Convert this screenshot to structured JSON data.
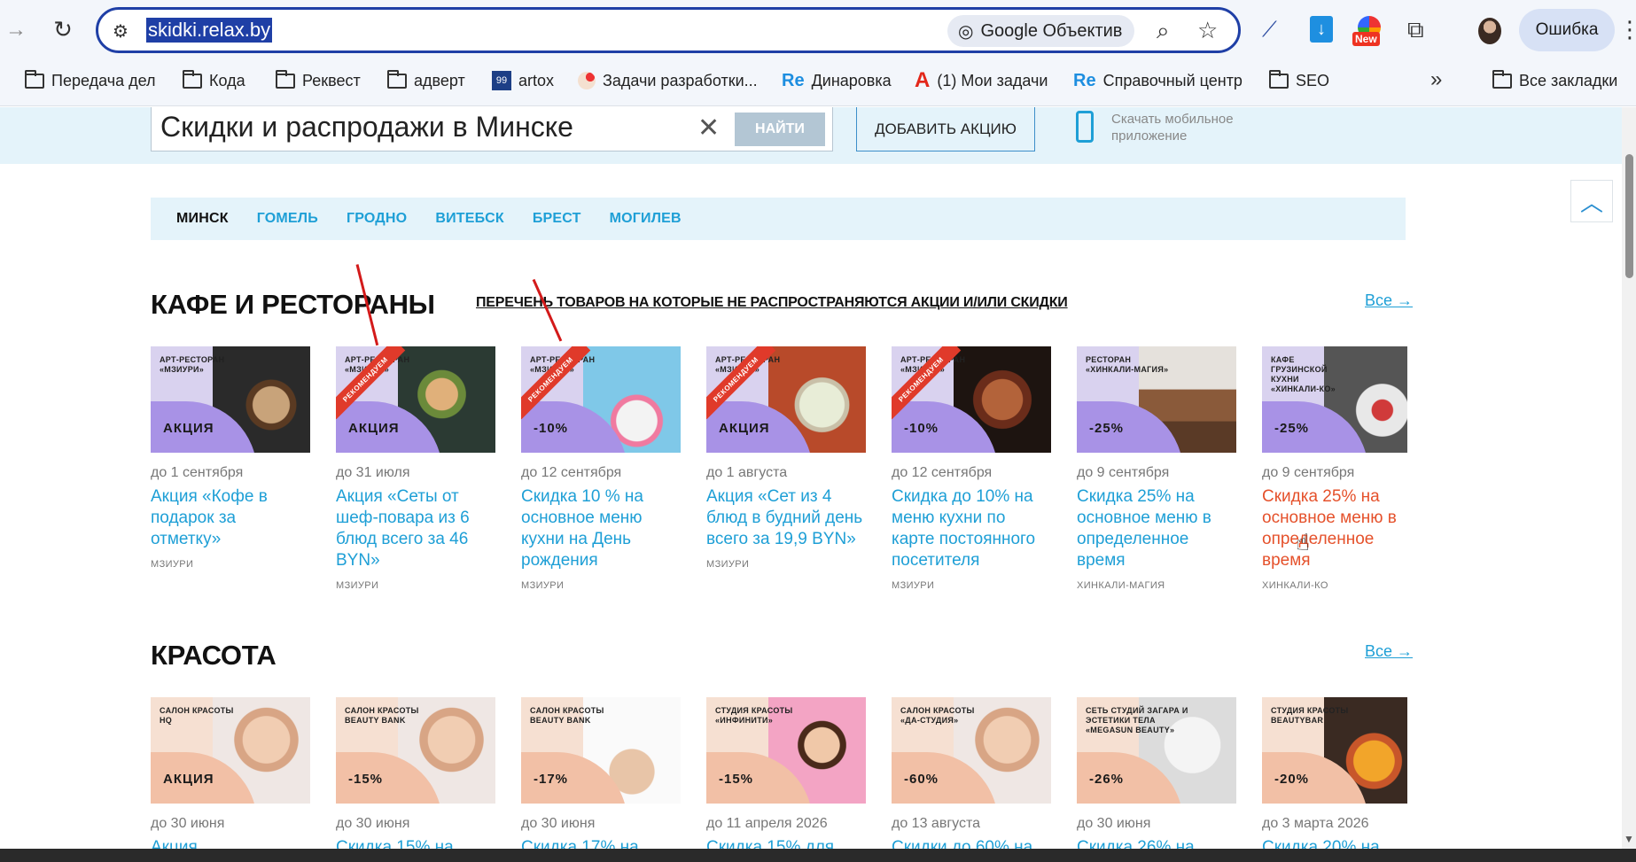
{
  "browser": {
    "url": "skidki.relax.by",
    "lens_label": "Google Объектив",
    "new_badge": "New",
    "profile_error": "Ошибка",
    "bookmarks": [
      {
        "label": "Передача дел",
        "icon": "folder-icon"
      },
      {
        "label": "Кода",
        "icon": "folder-icon"
      },
      {
        "label": "Реквест",
        "icon": "folder-icon"
      },
      {
        "label": "адверт",
        "icon": "folder-icon"
      },
      {
        "label": "artox",
        "icon": "artox-icon"
      },
      {
        "label": "Задачи разработки...",
        "icon": "app-icon"
      },
      {
        "label": "Динаровка",
        "icon": "re-icon"
      },
      {
        "label": "(1) Мои задачи",
        "icon": "a-icon"
      },
      {
        "label": "Справочный центр",
        "icon": "re-icon"
      },
      {
        "label": "SEO",
        "icon": "folder-icon"
      }
    ],
    "all_bookmarks": "Все закладки",
    "artox_icon_text": "99",
    "re_icon_text": "Re",
    "a_icon_text": "A"
  },
  "header": {
    "search_value": "Скидки и распродажи в Минске",
    "search_clear": "✕",
    "find_label": "НАЙТИ",
    "add_label": "ДОБАВИТЬ АКЦИЮ",
    "app_text": "Скачать мобильное приложение"
  },
  "cities": [
    "МИНСК",
    "ГОМЕЛЬ",
    "ГРОДНО",
    "ВИТЕБСК",
    "БРЕСТ",
    "МОГИЛЕВ"
  ],
  "sections": [
    {
      "title": "КАФЕ И РЕСТОРАНЫ",
      "notice": "ПЕРЕЧЕНЬ ТОВАРОВ НА КОТОРЫЕ НЕ РАСПРОСТРАНЯЮТСЯ АКЦИИ И/ИЛИ СКИДКИ",
      "all": "Все →",
      "cards": [
        {
          "venue": "АРТ-РЕСТОРАН «МЗИУРИ»",
          "badge": "АКЦИЯ",
          "ribbon": "",
          "date": "до 1 сентября",
          "title": "Акция «Кофе в подарок за отметку»",
          "vendor": "МЗИУРИ"
        },
        {
          "venue": "АРТ-РЕСТОРАН «МЗИУРИ»",
          "badge": "АКЦИЯ",
          "ribbon": "РЕКОМЕНДУЕМ",
          "date": "до 31 июля",
          "title": "Акция «Сеты от шеф-повара из 6 блюд всего за 46 BYN»",
          "vendor": "МЗИУРИ"
        },
        {
          "venue": "АРТ-РЕСТОРАН «МЗИУРИ»",
          "badge": "-10%",
          "ribbon": "РЕКОМЕНДУЕМ",
          "date": "до 12 сентября",
          "title": "Скидка 10 % на основное меню кухни на День рождения",
          "vendor": "МЗИУРИ"
        },
        {
          "venue": "АРТ-РЕСТОРАН «МЗИУРИ»",
          "badge": "АКЦИЯ",
          "ribbon": "РЕКОМЕНДУЕМ",
          "date": "до 1 августа",
          "title": "Акция «Сет из 4 блюд в будний день всего за 19,9 BYN»",
          "vendor": "МЗИУРИ"
        },
        {
          "venue": "АРТ-РЕСТОРАН «МЗИУРИ»",
          "badge": "-10%",
          "ribbon": "РЕКОМЕНДУЕМ",
          "date": "до 12 сентября",
          "title": "Скидка до 10% на меню кухни по карте постоянного посетителя",
          "vendor": "МЗИУРИ"
        },
        {
          "venue": "РЕСТОРАН «ХИНКАЛИ-МАГИЯ»",
          "badge": "-25%",
          "ribbon": "",
          "date": "до 9 сентября",
          "title": "Скидка 25% на основное меню в определенное время",
          "vendor": "ХИНКАЛИ-МАГИЯ"
        },
        {
          "venue": "КАФЕ ГРУЗИНСКОЙ КУХНИ «ХИНКАЛИ-КО»",
          "badge": "-25%",
          "ribbon": "",
          "date": "до 9 сентября",
          "title": "Скидка 25% на основное меню в определенное время",
          "vendor": "ХИНКАЛИ-КО"
        }
      ]
    },
    {
      "title": "КРАСОТА",
      "all": "Все →",
      "cards": [
        {
          "venue": "САЛОН КРАСОТЫ HQ",
          "badge": "АКЦИЯ",
          "date": "до 30 июня",
          "title": "Акция"
        },
        {
          "venue": "САЛОН КРАСОТЫ BEAUTY BANK",
          "badge": "-15%",
          "date": "до 30 июня",
          "title": "Скидка 15% на"
        },
        {
          "venue": "САЛОН КРАСОТЫ BEAUTY BANK",
          "badge": "-17%",
          "date": "до 30 июня",
          "title": "Скидка 17% на"
        },
        {
          "venue": "СТУДИЯ КРАСОТЫ «ИНФИНИТИ»",
          "badge": "-15%",
          "date": "до 11 апреля 2026",
          "title": "Скидка 15% для"
        },
        {
          "venue": "САЛОН КРАСОТЫ «ДА-СТУДИЯ»",
          "badge": "-60%",
          "date": "до 13 августа",
          "title": "Скидки до 60% на"
        },
        {
          "venue": "СЕТЬ СТУДИЙ ЗАГАРА И ЭСТЕТИКИ ТЕЛА «MEGASUN BEAUTY»",
          "badge": "-26%",
          "date": "до 30 июня",
          "title": "Скидка 26% на"
        },
        {
          "venue": "СТУДИЯ КРАСОТЫ BEAUTYBAR",
          "badge": "-20%",
          "date": "до 3 марта 2026",
          "title": "Скидка 20% на"
        }
      ]
    }
  ],
  "colors": {
    "accent": "#1e9fd6",
    "hover": "#e5512b",
    "ribbon": "#e03a2a",
    "omnibox_border": "#1f3fa6"
  }
}
